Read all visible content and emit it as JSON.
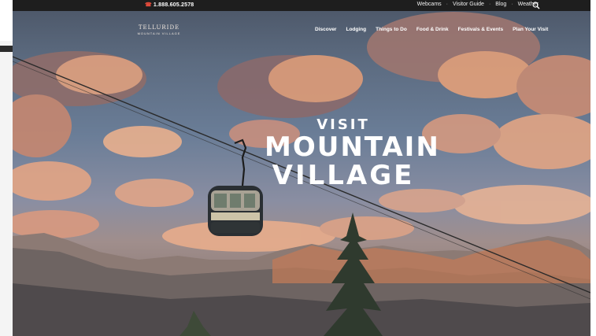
{
  "topbar": {
    "phone": "1.888.605.2578",
    "links": [
      "Webcams",
      "Visitor Guide",
      "Blog",
      "Weather"
    ],
    "separator": "·"
  },
  "logo": {
    "line1": "TELLURIDE",
    "line2": "MOUNTAIN VILLAGE"
  },
  "nav": [
    "Discover",
    "Lodging",
    "Things to Do",
    "Food & Drink",
    "Festivals & Events",
    "Plan Your Visit"
  ],
  "hero": {
    "line1": "VISIT",
    "line2": "MOUNTAIN",
    "line3": "VILLAGE"
  },
  "colors": {
    "accent": "#e04a3a",
    "topbar": "#1e1e1e",
    "text": "#ffffff"
  }
}
